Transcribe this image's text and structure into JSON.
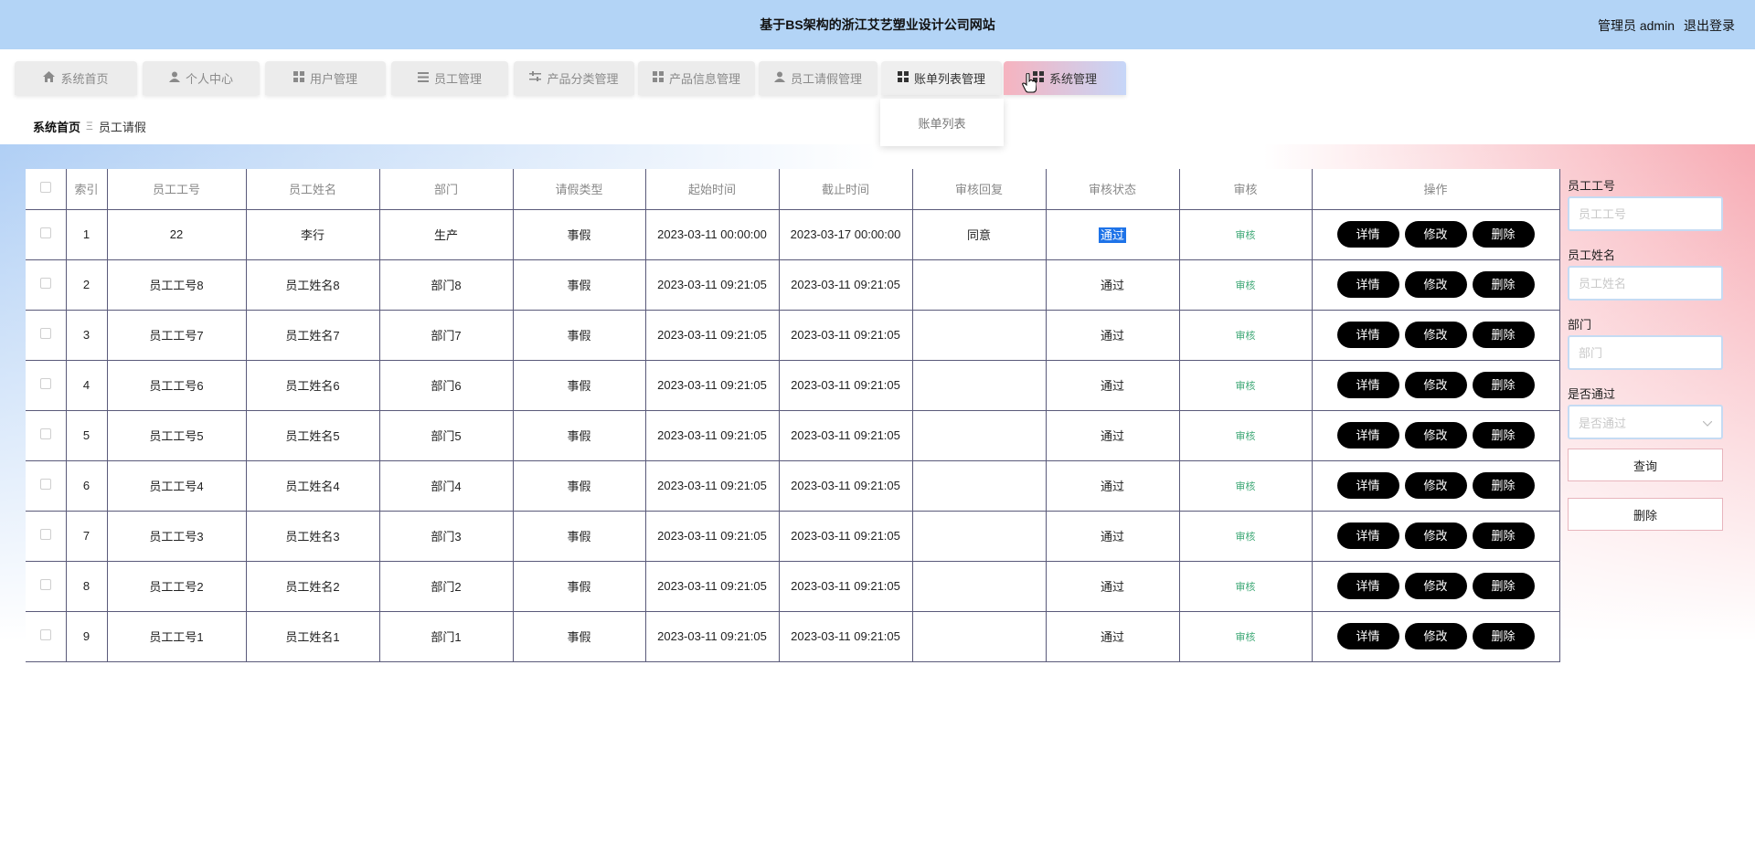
{
  "header": {
    "title": "基于BS架构的浙江艾艺塑业设计公司网站",
    "user_label": "管理员 admin",
    "logout_label": "退出登录"
  },
  "nav": {
    "items": [
      {
        "label": "系统首页",
        "icon": "home-icon"
      },
      {
        "label": "个人中心",
        "icon": "user-icon"
      },
      {
        "label": "用户管理",
        "icon": "grid-icon"
      },
      {
        "label": "员工管理",
        "icon": "list-icon"
      },
      {
        "label": "产品分类管理",
        "icon": "sliders-icon"
      },
      {
        "label": "产品信息管理",
        "icon": "grid-icon"
      },
      {
        "label": "员工请假管理",
        "icon": "user-icon"
      },
      {
        "label": "账单列表管理",
        "icon": "grid-icon"
      },
      {
        "label": "系统管理",
        "icon": "grid-icon"
      }
    ],
    "active_gradient": [
      "#f6b3bf",
      "#c6d6f8"
    ],
    "dropdown_item": "账单列表"
  },
  "breadcrumb": {
    "home": "系统首页",
    "separator": "Ξ",
    "current": "员工请假"
  },
  "table": {
    "headers": [
      "索引",
      "员工工号",
      "员工姓名",
      "部门",
      "请假类型",
      "起始时间",
      "截止时间",
      "审核回复",
      "审核状态",
      "审核",
      "操作"
    ],
    "rows": [
      [
        "1",
        "22",
        "李行",
        "生产",
        "事假",
        "2023-03-11 00:00:00",
        "2023-03-17 00:00:00",
        "同意",
        "通过",
        "审核"
      ],
      [
        "2",
        "员工工号8",
        "员工姓名8",
        "部门8",
        "事假",
        "2023-03-11 09:21:05",
        "2023-03-11 09:21:05",
        "",
        "通过",
        "审核"
      ],
      [
        "3",
        "员工工号7",
        "员工姓名7",
        "部门7",
        "事假",
        "2023-03-11 09:21:05",
        "2023-03-11 09:21:05",
        "",
        "通过",
        "审核"
      ],
      [
        "4",
        "员工工号6",
        "员工姓名6",
        "部门6",
        "事假",
        "2023-03-11 09:21:05",
        "2023-03-11 09:21:05",
        "",
        "通过",
        "审核"
      ],
      [
        "5",
        "员工工号5",
        "员工姓名5",
        "部门5",
        "事假",
        "2023-03-11 09:21:05",
        "2023-03-11 09:21:05",
        "",
        "通过",
        "审核"
      ],
      [
        "6",
        "员工工号4",
        "员工姓名4",
        "部门4",
        "事假",
        "2023-03-11 09:21:05",
        "2023-03-11 09:21:05",
        "",
        "通过",
        "审核"
      ],
      [
        "7",
        "员工工号3",
        "员工姓名3",
        "部门3",
        "事假",
        "2023-03-11 09:21:05",
        "2023-03-11 09:21:05",
        "",
        "通过",
        "审核"
      ],
      [
        "8",
        "员工工号2",
        "员工姓名2",
        "部门2",
        "事假",
        "2023-03-11 09:21:05",
        "2023-03-11 09:21:05",
        "",
        "通过",
        "审核"
      ],
      [
        "9",
        "员工工号1",
        "员工姓名1",
        "部门1",
        "事假",
        "2023-03-11 09:21:05",
        "2023-03-11 09:21:05",
        "",
        "通过",
        "审核"
      ]
    ],
    "actions": {
      "detail": "详情",
      "edit": "修改",
      "delete": "删除"
    },
    "audit_color": "#3ea876",
    "selected_status_color": "#1e73e8"
  },
  "search": {
    "emp_no_label": "员工工号",
    "emp_no_placeholder": "员工工号",
    "emp_name_label": "员工姓名",
    "emp_name_placeholder": "员工姓名",
    "dept_label": "部门",
    "dept_placeholder": "部门",
    "passed_label": "是否通过",
    "passed_placeholder": "是否通过",
    "query_button": "查询",
    "delete_button": "删除"
  },
  "colors": {
    "header_bg": "#b3d4f6",
    "action_button_bg": "#000000"
  }
}
